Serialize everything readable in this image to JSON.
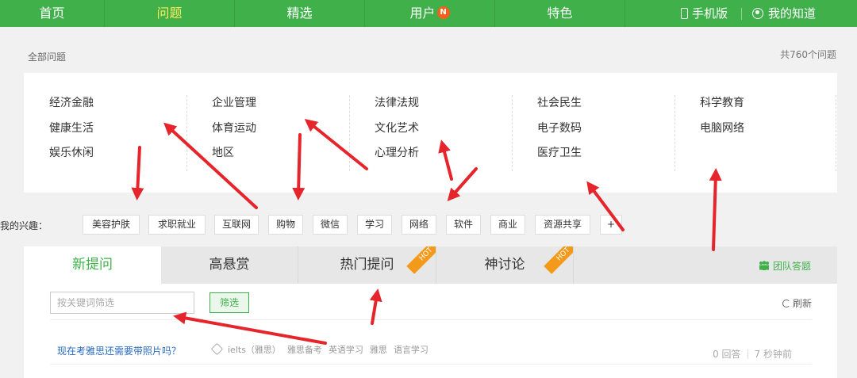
{
  "nav": {
    "items": [
      {
        "label": "首页"
      },
      {
        "label": "问题"
      },
      {
        "label": "精选"
      },
      {
        "label": "用户"
      },
      {
        "label": "特色"
      }
    ],
    "user_badge": "N",
    "mobile_label": "手机版",
    "my_label": "我的知道"
  },
  "crumb": "全部问题",
  "total": "共760个问题",
  "categories": [
    [
      "经济金融",
      "健康生活",
      "娱乐休闲"
    ],
    [
      "企业管理",
      "体育运动",
      "地区"
    ],
    [
      "法律法规",
      "文化艺术",
      "心理分析"
    ],
    [
      "社会民生",
      "电子数码",
      "医疗卫生"
    ],
    [
      "科学教育",
      "电脑网络"
    ]
  ],
  "interests": {
    "label": "我的兴趣：",
    "tags": [
      "美容护肤",
      "求职就业",
      "互联网",
      "购物",
      "微信",
      "学习",
      "网络",
      "软件",
      "商业",
      "资源共享",
      "+"
    ]
  },
  "tabs": [
    {
      "label": "新提问"
    },
    {
      "label": "高悬赏"
    },
    {
      "label": "热门提问",
      "hot": "HOT"
    },
    {
      "label": "神讨论",
      "hot": "HOT"
    }
  ],
  "team_label": "团队答题",
  "search": {
    "placeholder": "按关键词筛选",
    "button": "筛选"
  },
  "refresh_label": "刷新",
  "question": {
    "title": "现在考雅思还需要带照片吗？",
    "tags": [
      "ielts（雅思）",
      "雅思备考",
      "英语学习",
      "雅思",
      "语言学习"
    ],
    "answers": "0 回答",
    "time": "7 秒钟前"
  },
  "colors": {
    "brand_green": "#3fb04a",
    "nav_active": "#ffe95a",
    "hot_badge": "#f49a1a",
    "badge_n": "#f5601d",
    "arrow_red": "#e5242b",
    "link_blue": "#2a6bc0"
  }
}
